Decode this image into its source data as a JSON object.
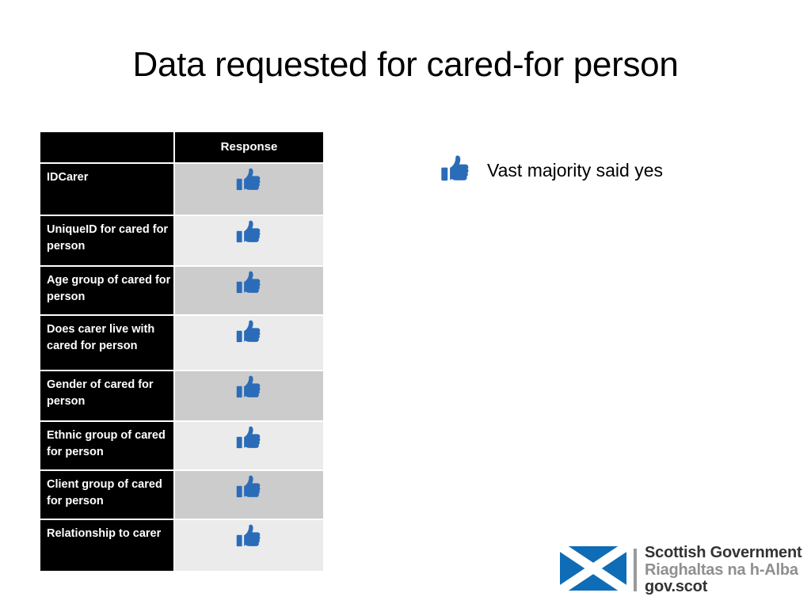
{
  "slide": {
    "title": "Data requested for cared-for person",
    "background_color": "#ffffff"
  },
  "table": {
    "columns": [
      {
        "header": "",
        "name": "field-column"
      },
      {
        "header": "Response",
        "name": "response-column"
      }
    ],
    "header_bg": "#000000",
    "header_text_color": "#ffffff",
    "label_bg": "#000000",
    "label_text_color": "#ffffff",
    "row_shade_dark": "#cccccc",
    "row_shade_light": "#ebebeb",
    "rows": [
      {
        "label": "IDCarer",
        "response_icon": "thumbs-up-icon",
        "shade": "dark"
      },
      {
        "label": "UniqueID for cared for person",
        "response_icon": "thumbs-up-icon",
        "shade": "light"
      },
      {
        "label": "Age group of cared for person",
        "response_icon": "thumbs-up-icon",
        "shade": "dark"
      },
      {
        "label": "Does carer live with cared for person",
        "response_icon": "thumbs-up-icon",
        "shade": "light"
      },
      {
        "label": "Gender of cared for person",
        "response_icon": "thumbs-up-icon",
        "shade": "dark"
      },
      {
        "label": "Ethnic group of cared for person",
        "response_icon": "thumbs-up-icon",
        "shade": "light"
      },
      {
        "label": "Client group of cared for person",
        "response_icon": "thumbs-up-icon",
        "shade": "dark"
      },
      {
        "label": "Relationship to carer",
        "response_icon": "thumbs-up-icon",
        "shade": "light"
      }
    ]
  },
  "annotation": {
    "icon": "thumbs-up-icon",
    "text": "Vast majority said yes",
    "icon_color": "#2b6cb8"
  },
  "logo": {
    "flag_icon": "saltire-flag-icon",
    "flag_blue": "#0f6cb6",
    "flag_white": "#ffffff",
    "line1": "Scottish Government",
    "line2": "Riaghaltas na h-Alba",
    "line3": "gov.scot",
    "line1_color": "#333333",
    "line2_color": "#8f8f8f",
    "line3_color": "#333333"
  }
}
